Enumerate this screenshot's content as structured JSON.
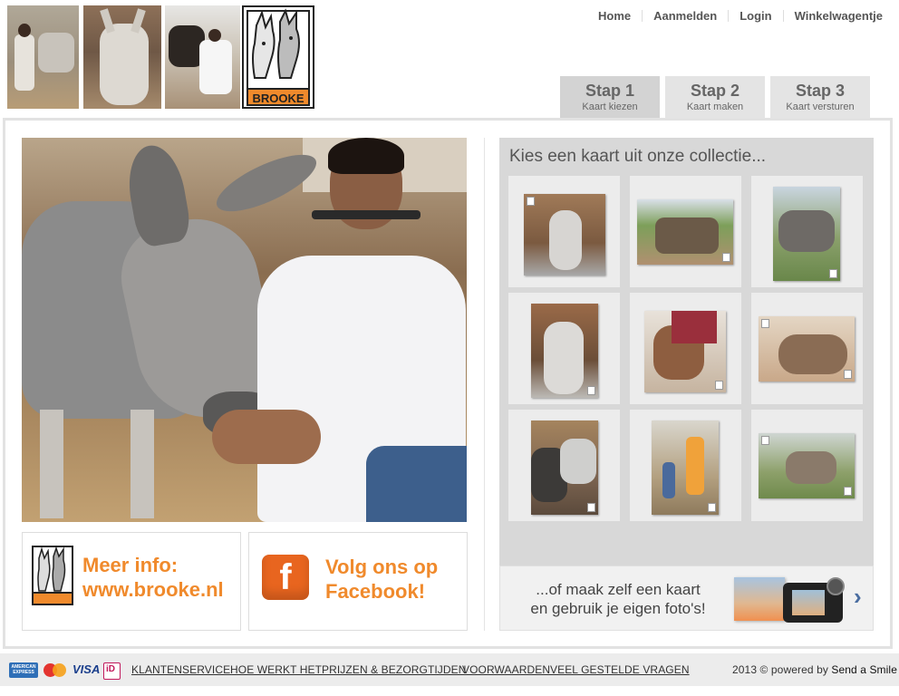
{
  "brand": {
    "logo_text": "BROOKE"
  },
  "nav": {
    "home": "Home",
    "signup": "Aanmelden",
    "login": "Login",
    "cart": "Winkelwagentje"
  },
  "steps": [
    {
      "title": "Stap 1",
      "subtitle": "Kaart kiezen"
    },
    {
      "title": "Stap 2",
      "subtitle": "Kaart maken"
    },
    {
      "title": "Stap 3",
      "subtitle": "Kaart versturen"
    }
  ],
  "info_box": {
    "line1": "Meer info:",
    "line2": "www.brooke.nl"
  },
  "facebook_box": {
    "line1": "Volg ons op",
    "line2": "Facebook!",
    "icon_letter": "f"
  },
  "collection": {
    "title": "Kies een kaart uit onze collectie..."
  },
  "own_photo": {
    "line1": "...of maak zelf een kaart",
    "line2": "en gebruik je eigen foto's!",
    "chevron": "›"
  },
  "footer": {
    "payment": {
      "amex": "AMERICAN EXPRESS",
      "visa": "VISA",
      "ideal": "iD"
    },
    "links": [
      "KLANTENSERVICE",
      "HOE WERKT HET",
      "PRIJZEN & BEZORGTIJDEN",
      "VOORWAARDEN",
      "VEEL GESTELDE VRAGEN"
    ],
    "copyright": "2013 © powered by",
    "powered_by": "Send a Smile"
  },
  "colors": {
    "accent": "#f08a2c",
    "panel": "#d8d8d8",
    "footer": "#ececec"
  }
}
